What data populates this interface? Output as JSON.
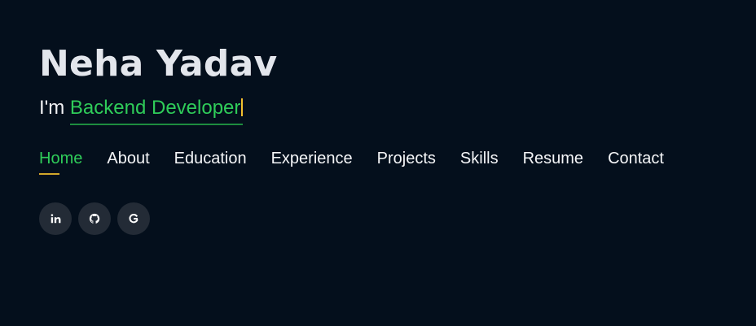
{
  "hero": {
    "name": "Neha Yadav",
    "intro": "I'm ",
    "role": "Backend Developer"
  },
  "nav": {
    "items": [
      {
        "label": "Home",
        "active": true
      },
      {
        "label": "About"
      },
      {
        "label": "Education"
      },
      {
        "label": "Experience"
      },
      {
        "label": "Projects"
      },
      {
        "label": "Skills"
      },
      {
        "label": "Resume"
      },
      {
        "label": "Contact"
      }
    ]
  },
  "socials": [
    {
      "icon": "linkedin-icon"
    },
    {
      "icon": "github-icon"
    },
    {
      "icon": "google-icon"
    }
  ],
  "colors": {
    "background": "#040f1c",
    "accent_green": "#2fcc59",
    "accent_gold": "#d2a82a",
    "social_bg": "#232b36"
  }
}
